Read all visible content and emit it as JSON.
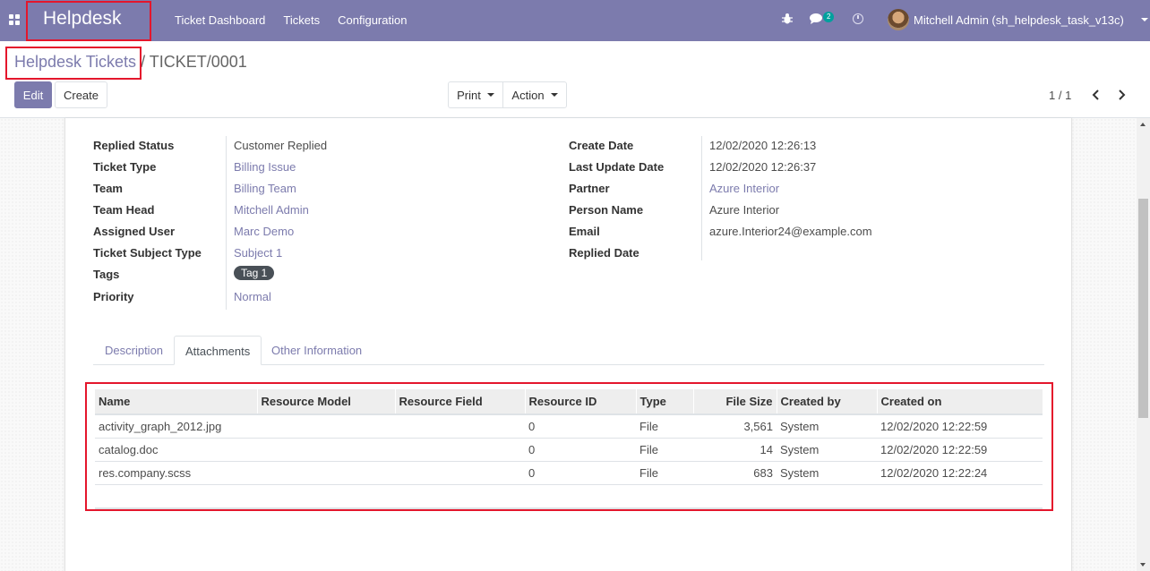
{
  "navbar": {
    "brand": "Helpdesk",
    "menu": [
      "Ticket Dashboard",
      "Tickets",
      "Configuration"
    ],
    "chat_count": "2",
    "user": "Mitchell Admin (sh_helpdesk_task_v13c)"
  },
  "breadcrumb": {
    "parent": "Helpdesk Tickets",
    "separator": " / ",
    "current": "TICKET/0001"
  },
  "buttons": {
    "edit": "Edit",
    "create": "Create",
    "print": "Print",
    "action": "Action"
  },
  "pager": {
    "value": "1 / 1"
  },
  "form": {
    "left": [
      {
        "label": "Replied Status",
        "value": "Customer Replied",
        "link": false
      },
      {
        "label": "Ticket Type",
        "value": "Billing Issue",
        "link": true
      },
      {
        "label": "Team",
        "value": "Billing Team",
        "link": true
      },
      {
        "label": "Team Head",
        "value": "Mitchell Admin",
        "link": true
      },
      {
        "label": "Assigned User",
        "value": "Marc Demo",
        "link": true
      },
      {
        "label": "Ticket Subject Type",
        "value": "Subject 1",
        "link": true
      },
      {
        "label": "Tags",
        "value": "Tag 1",
        "link": false
      },
      {
        "label": "Priority",
        "value": "Normal",
        "link": true
      }
    ],
    "right": [
      {
        "label": "Create Date",
        "value": "12/02/2020 12:26:13",
        "link": false
      },
      {
        "label": "Last Update Date",
        "value": "12/02/2020 12:26:37",
        "link": false
      },
      {
        "label": "Partner",
        "value": "Azure Interior",
        "link": true
      },
      {
        "label": "Person Name",
        "value": "Azure Interior",
        "link": false
      },
      {
        "label": "Email",
        "value": "azure.Interior24@example.com",
        "link": false
      },
      {
        "label": "Replied Date",
        "value": "",
        "link": false
      }
    ]
  },
  "tabs": [
    "Description",
    "Attachments",
    "Other Information"
  ],
  "active_tab": "Attachments",
  "attachments": {
    "columns": [
      "Name",
      "Resource Model",
      "Resource Field",
      "Resource ID",
      "Type",
      "File Size",
      "Created by",
      "Created on"
    ],
    "rows": [
      [
        "activity_graph_2012.jpg",
        "",
        "",
        "0",
        "File",
        "3,561",
        "System",
        "12/02/2020 12:22:59"
      ],
      [
        "catalog.doc",
        "",
        "",
        "0",
        "File",
        "14",
        "System",
        "12/02/2020 12:22:59"
      ],
      [
        "res.company.scss",
        "",
        "",
        "0",
        "File",
        "683",
        "System",
        "12/02/2020 12:22:24"
      ]
    ]
  },
  "colors": {
    "brand": "#7c7bad",
    "highlight": "#e4162c",
    "badge": "#00a09d"
  }
}
